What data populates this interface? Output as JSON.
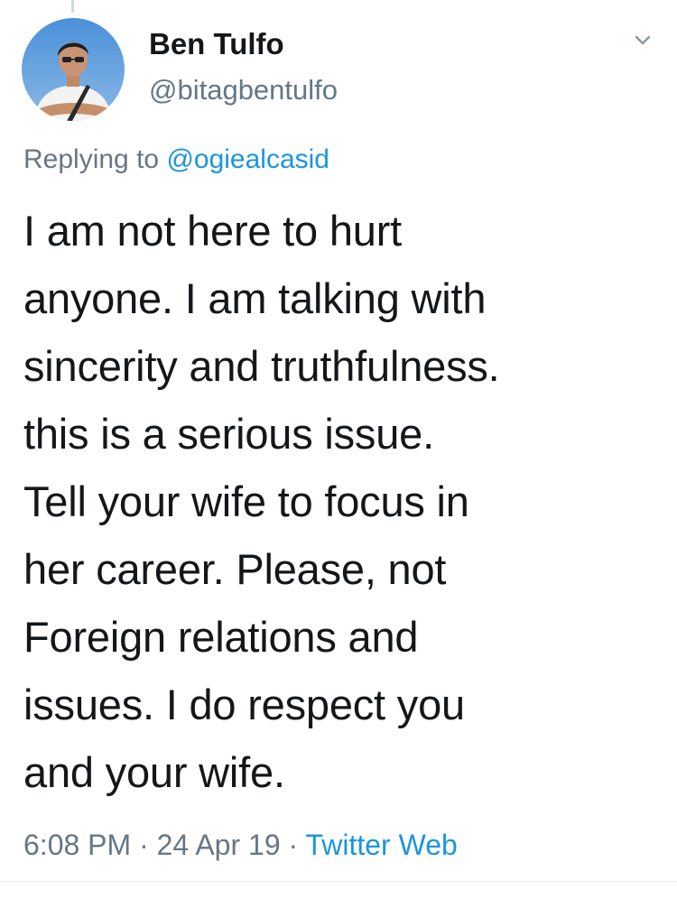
{
  "author": {
    "name": "Ben Tulfo",
    "handle": "@bitagbentulfo",
    "avatar_icon": "user-photo-avatar"
  },
  "reply": {
    "prefix": "Replying to ",
    "mention": "@ogiealcasid"
  },
  "tweet": {
    "lines": [
      "I am not here to hurt",
      "anyone. I am talking with",
      "sincerity and truthfulness.",
      "this is a serious issue.",
      "Tell your wife to focus in",
      "her career. Please, not",
      "Foreign relations and",
      "issues. I do respect you",
      "and your wife."
    ]
  },
  "meta": {
    "time": "6:08 PM",
    "sep1": " · ",
    "date": "24 Apr 19",
    "sep2": " · ",
    "source": "Twitter Web"
  },
  "icons": {
    "menu": "chevron-down-icon"
  },
  "colors": {
    "link": "#1b95e0",
    "muted": "#657786",
    "text": "#14171a"
  }
}
